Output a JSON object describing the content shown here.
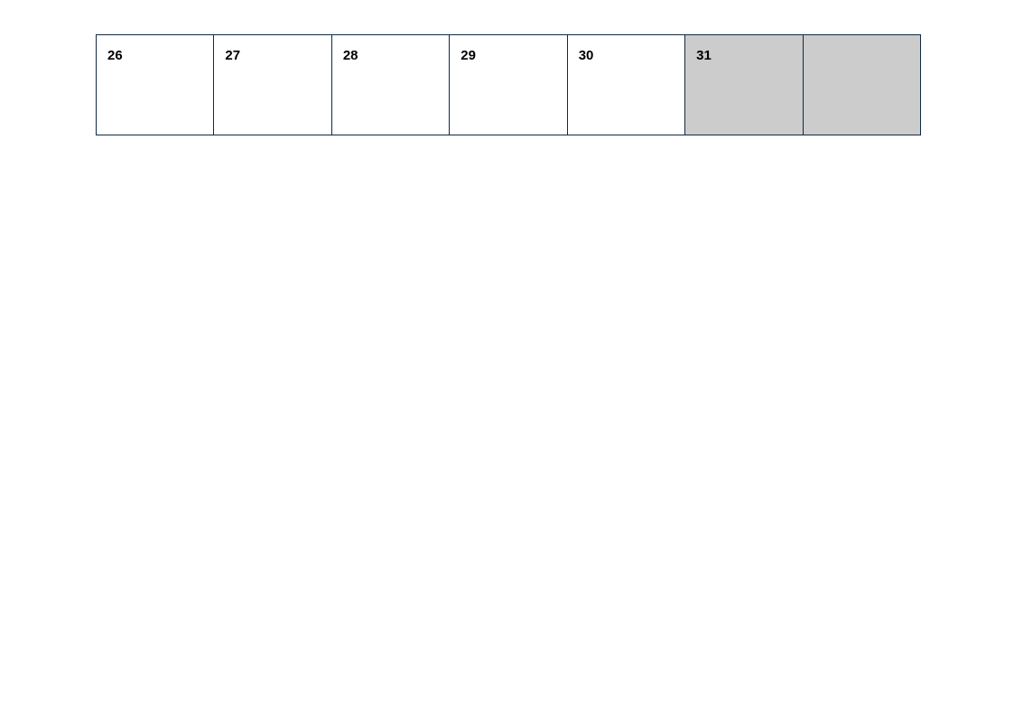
{
  "calendar": {
    "row": [
      {
        "day": "26",
        "shaded": false
      },
      {
        "day": "27",
        "shaded": false
      },
      {
        "day": "28",
        "shaded": false
      },
      {
        "day": "29",
        "shaded": false
      },
      {
        "day": "30",
        "shaded": false
      },
      {
        "day": "31",
        "shaded": true
      },
      {
        "day": "",
        "shaded": true
      }
    ]
  }
}
